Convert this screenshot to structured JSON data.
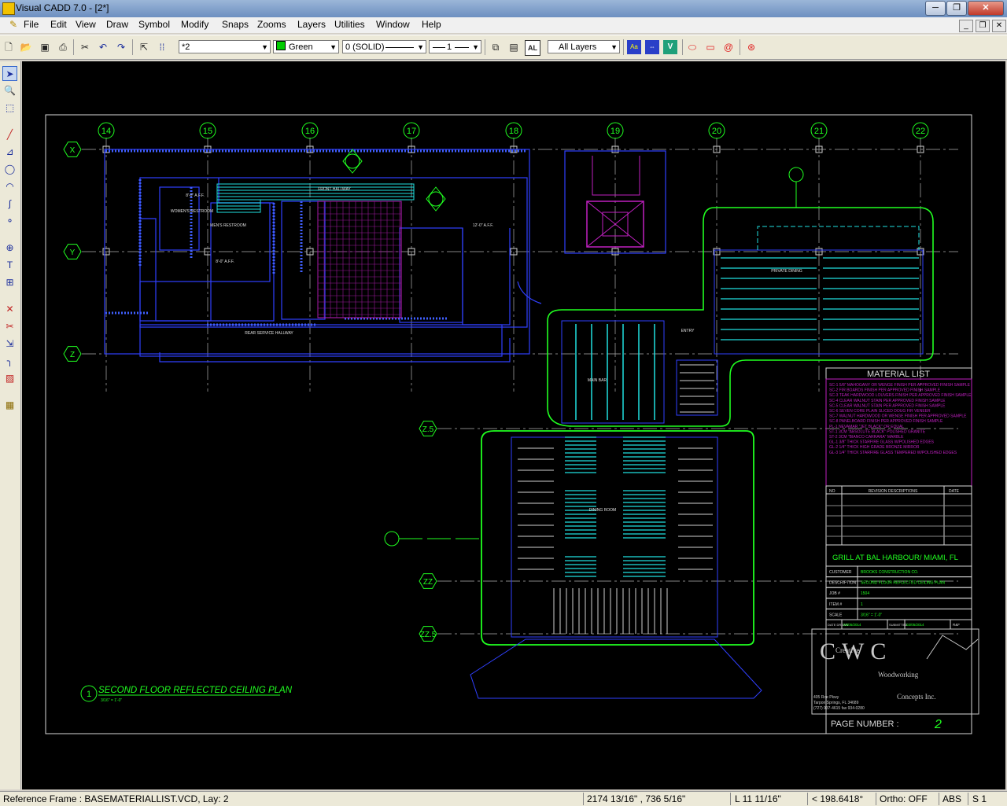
{
  "window": {
    "title": "Visual CADD 7.0 - [2*]",
    "minimize": "─",
    "restore": "❐",
    "close": "✕"
  },
  "menu": [
    "File",
    "Edit",
    "View",
    "Draw",
    "Symbol",
    "Modify",
    "Snaps",
    "Zooms",
    "Layers",
    "Utilities",
    "Window",
    "Help"
  ],
  "toolbar": {
    "layer_value": "*2",
    "color_value": "Green",
    "line_type_value": "0 (SOLID)",
    "line_width_value": "1",
    "layers_filter": "All Layers",
    "colors": {
      "swatch": "#00cc00"
    }
  },
  "drawing": {
    "grid_cols": [
      "14",
      "15",
      "16",
      "17",
      "18",
      "19",
      "20",
      "21",
      "22"
    ],
    "grid_rows": [
      "X",
      "Y",
      "Z",
      "Z.5",
      "ZZ",
      "ZZ.5"
    ],
    "room_labels": [
      "FRONT HALLWAY",
      "REAR SERVICE HALLWAY",
      "MEN'S RESTROOM",
      "WOMEN'S RESTROOM",
      "MAIN BAR",
      "ENTRY",
      "PRIVATE DINING",
      "DINING ROOM"
    ],
    "notes": [
      "12'-0\" A.F.F.",
      "8'-0\" A.F.F.",
      "8'-0\" A.F.F."
    ],
    "plan_title": "SECOND FLOOR REFLECTED CEILING PLAN",
    "plan_number": "1",
    "plan_scale": "3/16\" = 1'-0\"",
    "material_list": {
      "heading": "MATERIAL LIST",
      "items": [
        "SC-1 5/8\" MAHOGANY OR WENGE FINISH PER APPROVED FINISH SAMPLE",
        "SC-2 FIR BOARDS FINISH PER APPROVED FINISH SAMPLE",
        "SC-3 TEAK HARDWOOD LOUVERS FINISH PER APPROVED FINISH SAMPLE",
        "SC-4 CLEAR WALNUT STAIN PER APPROVED FINISH SAMPLE",
        "SC-5 CLEAR WALNUT STAIN PER APPROVED FINISH SAMPLE",
        "SC-6 SEVEN CORE PLAIN SLICED DOUG FIR VENEER",
        "SC-7 WALNUT HARDWOOD OR WENGE FINISH PER APPROVED SAMPLE",
        "SC-8 PANELBOARD FINISH PER APPROVED FINISH SAMPLE",
        "PL-1 NEVAMAR \"JET BLACK\" OR EQUAL",
        "ST-1 3CM \"ABSOLUTE BLACK\" POLISHED GRANITE",
        "ST-2 3CM \"BIANCO CARRARA\" MARBLE",
        "GL-1 3/8\" THICK STARFIRE GLASS W/POLISHED EDGES",
        "GL-2 1/4\" THICK HIGH GRADE BRONZE MIRROR",
        "GL-3 1/4\" THICK STARFIRE GLASS TEMPERED W/POLISHED EDGES"
      ]
    },
    "revisions": {
      "col_no": "NO",
      "col_desc": "REVISION DESCRIPTIONS",
      "col_date": "DATE"
    },
    "project_title": "GRILL AT BAL HARBOUR/ MIAMI, FL",
    "title_block": [
      {
        "label": "CUSTOMER",
        "value": "BROOKS CONSTRUCTION CO."
      },
      {
        "label": "DESCRIPTION",
        "value": "SECOND FLOOR REFLECTED CEILING PLAN"
      },
      {
        "label": "JOB #",
        "value": "1504"
      },
      {
        "label": "ITEM #",
        "value": "1"
      },
      {
        "label": "SCALE",
        "value": "3/16\" = 1'-0\""
      }
    ],
    "dates": {
      "drawn_label": "DATE DRAWN",
      "drawn": "03/05/2014",
      "submitted_label": "SUBMITTED",
      "submitted": "03/05/2014",
      "flag": "R&F"
    },
    "logo": {
      "line1": "Creative",
      "line2": "Woodworking",
      "line3": "Concepts Inc.",
      "badge": "CWC",
      "address": [
        "405 Roe Pkwy",
        "Tarpon Springs, FL 34689",
        "(727) 937-4615 fax 934-0280"
      ]
    },
    "page_label": "PAGE NUMBER :",
    "page_number": "2"
  },
  "status": {
    "reference_frame": "Reference Frame : BASEMATERIALLIST.VCD, Lay: 2",
    "coords": "2174 13/16\" ,  736 5/16\"",
    "length": "L 11 11/16\"",
    "angle": "< 198.6418°",
    "ortho": "Ortho: OFF",
    "abs": "ABS",
    "s": "S 1"
  }
}
